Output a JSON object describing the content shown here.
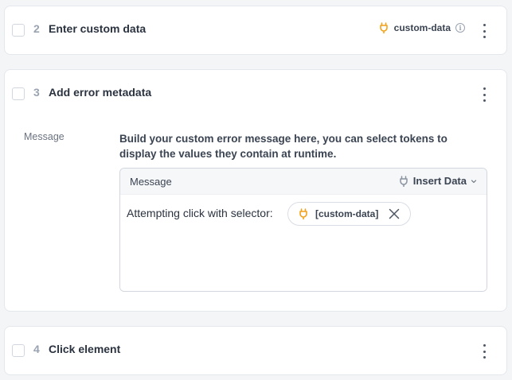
{
  "steps": [
    {
      "number": "2",
      "title": "Enter custom data",
      "tag": "custom-data",
      "tag_icon": "plug-icon",
      "info_icon": "info-icon"
    },
    {
      "number": "3",
      "title": "Add error metadata",
      "field": {
        "label": "Message",
        "description": "Build your custom error message here, you can select tokens to display the values they contain at runtime.",
        "editor": {
          "title": "Message",
          "insert_label": "Insert Data",
          "text": "Attempting click with selector:",
          "token": "[custom-data]"
        }
      }
    },
    {
      "number": "4",
      "title": "Click element"
    }
  ],
  "colors": {
    "accent_plug": "#f0a21b",
    "plug_gray": "#8a93a0",
    "background": "#f4f5f7",
    "card": "#ffffff"
  },
  "info_glyph": "i"
}
